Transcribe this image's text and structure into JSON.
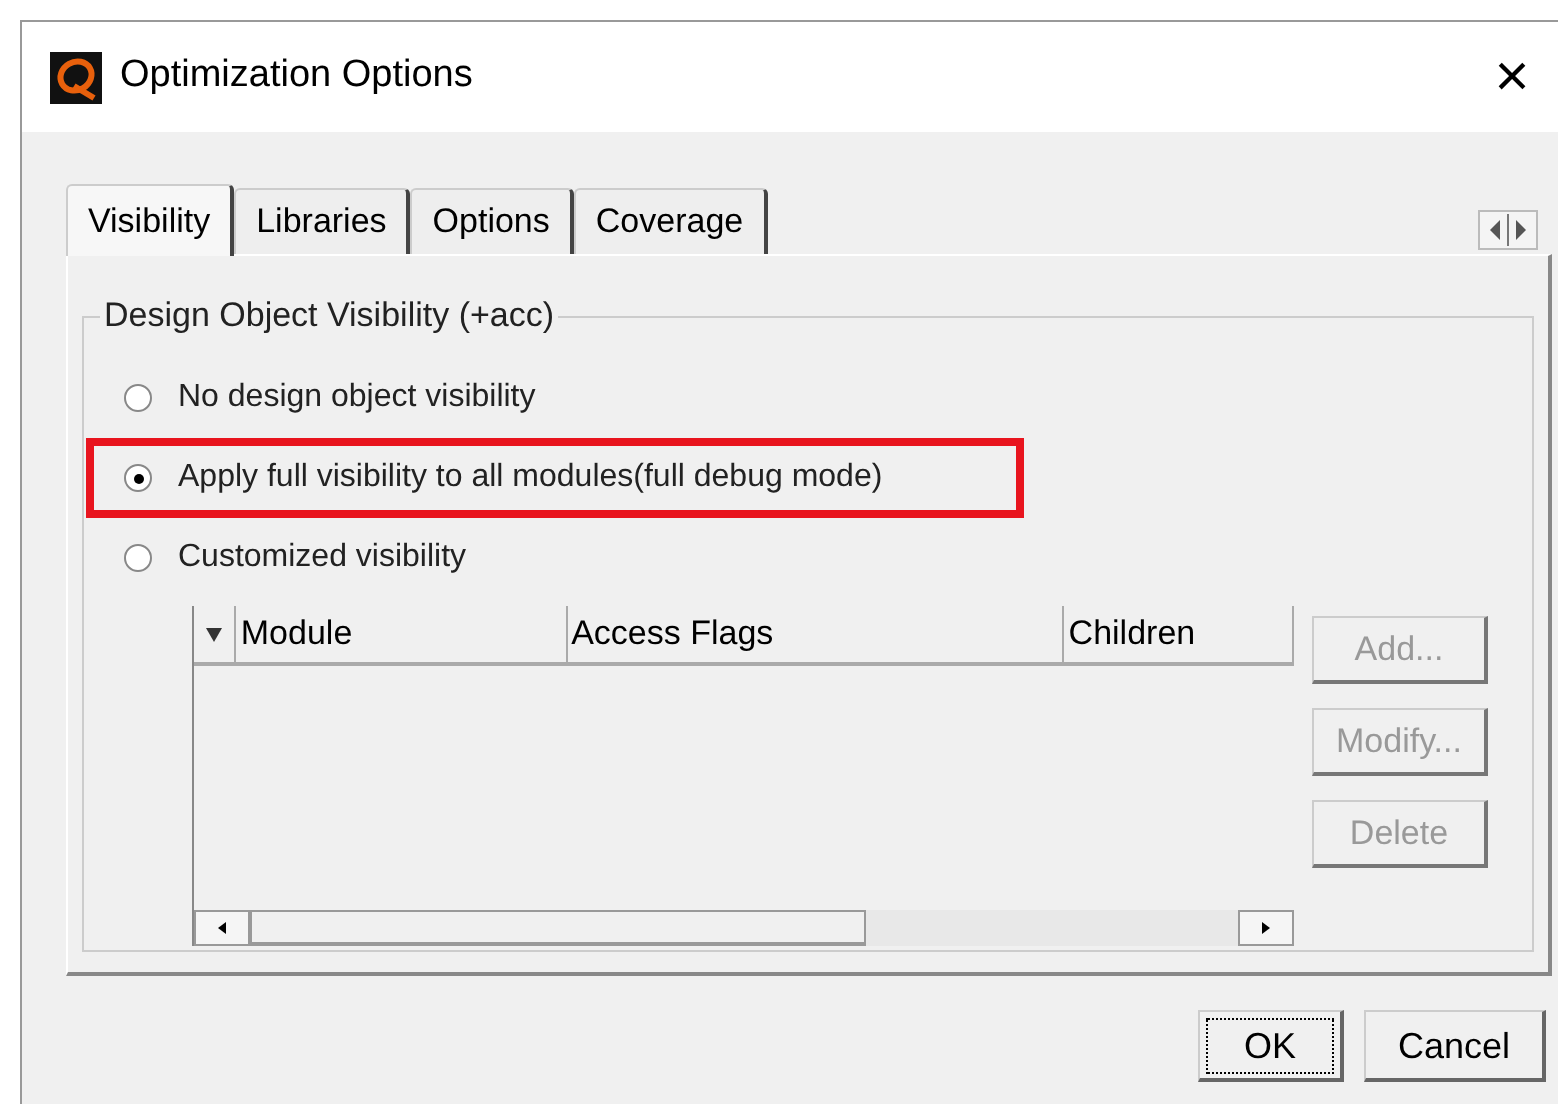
{
  "window": {
    "title": "Optimization Options",
    "close": "×"
  },
  "tabs": [
    {
      "label": "Visibility",
      "selected": true
    },
    {
      "label": "Libraries",
      "selected": false
    },
    {
      "label": "Options",
      "selected": false
    },
    {
      "label": "Coverage",
      "selected": false
    }
  ],
  "group": {
    "title": "Design Object Visibility (+acc)",
    "options": [
      {
        "label": "No design object visibility",
        "selected": false,
        "highlighted": false
      },
      {
        "label": "Apply full visibility to all modules(full debug mode)",
        "selected": true,
        "highlighted": true
      },
      {
        "label": "Customized visibility",
        "selected": false,
        "highlighted": false
      }
    ]
  },
  "table": {
    "columns": [
      "Module",
      "Access Flags",
      "Children"
    ]
  },
  "side_buttons": [
    {
      "label": "Add...",
      "disabled": true
    },
    {
      "label": "Modify...",
      "disabled": true
    },
    {
      "label": "Delete",
      "disabled": true
    }
  ],
  "buttons": [
    {
      "label": "OK",
      "focused": true
    },
    {
      "label": "Cancel",
      "focused": false
    }
  ]
}
